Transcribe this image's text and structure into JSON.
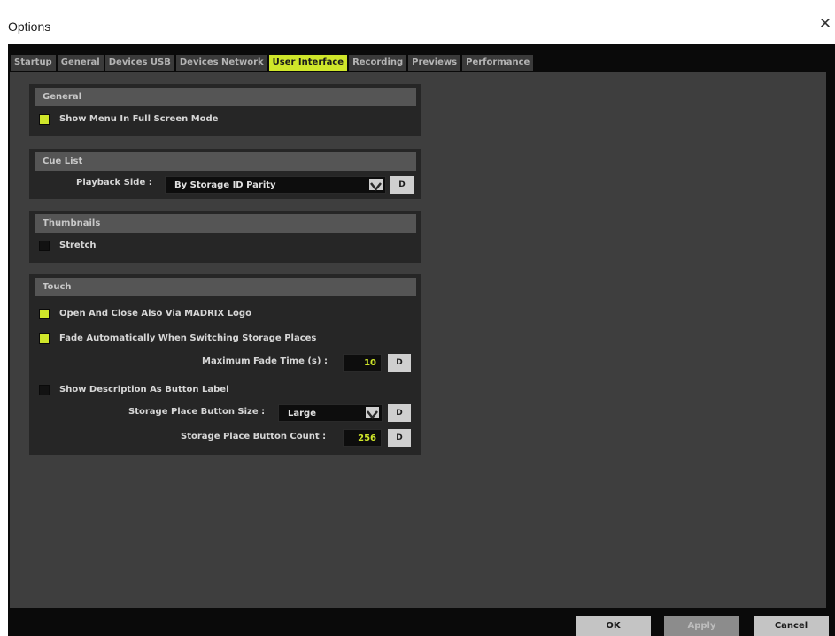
{
  "window": {
    "title": "Options",
    "close_glyph": "✕"
  },
  "tabs": [
    {
      "label": "Startup",
      "active": false
    },
    {
      "label": "General",
      "active": false
    },
    {
      "label": "Devices USB",
      "active": false
    },
    {
      "label": "Devices Network",
      "active": false
    },
    {
      "label": "User Interface",
      "active": true
    },
    {
      "label": "Recording",
      "active": false
    },
    {
      "label": "Previews",
      "active": false
    },
    {
      "label": "Performance",
      "active": false
    }
  ],
  "groups": {
    "general": {
      "title": "General",
      "show_menu_fullscreen": {
        "label": "Show Menu In Full Screen Mode",
        "checked": true
      }
    },
    "cue_list": {
      "title": "Cue List",
      "playback_side_label": "Playback Side :",
      "playback_side_value": "By Storage ID Parity",
      "default_label": "D"
    },
    "thumbnails": {
      "title": "Thumbnails",
      "stretch": {
        "label": "Stretch",
        "checked": false
      }
    },
    "touch": {
      "title": "Touch",
      "open_close_logo": {
        "label": "Open And Close Also Via MADRIX Logo",
        "checked": true
      },
      "fade_auto": {
        "label": "Fade Automatically When Switching Storage Places",
        "checked": true
      },
      "max_fade_label": "Maximum Fade Time (s) :",
      "max_fade_value": "10",
      "show_description": {
        "label": "Show Description As Button Label",
        "checked": false
      },
      "button_size_label": "Storage Place Button Size :",
      "button_size_value": "Large",
      "button_count_label": "Storage Place Button Count :",
      "button_count_value": "256",
      "default_label": "D"
    }
  },
  "footer": {
    "ok": "OK",
    "apply": "Apply",
    "cancel": "Cancel"
  },
  "colors": {
    "accent": "#cfe62a",
    "panel": "#3e3e3e",
    "group": "#262626"
  }
}
